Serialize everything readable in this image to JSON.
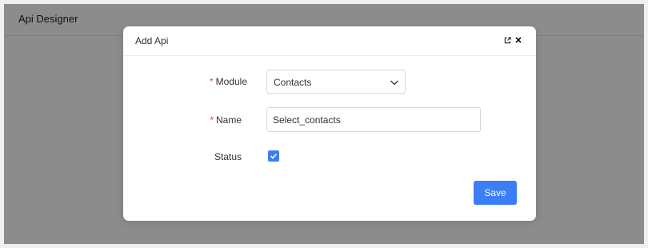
{
  "app": {
    "title": "Api Designer"
  },
  "modal": {
    "title": "Add Api",
    "icons": {
      "expand": "expand-icon",
      "close": "close-icon"
    }
  },
  "form": {
    "module": {
      "label": "Module",
      "required": true,
      "value": "Contacts"
    },
    "name": {
      "label": "Name",
      "required": true,
      "value": "Select_contacts"
    },
    "status": {
      "label": "Status",
      "checked": true
    }
  },
  "actions": {
    "save_label": "Save"
  },
  "colors": {
    "primary": "#3b7ef6",
    "required": "#e5484d",
    "mask": "rgba(0,0,0,0.45)"
  }
}
